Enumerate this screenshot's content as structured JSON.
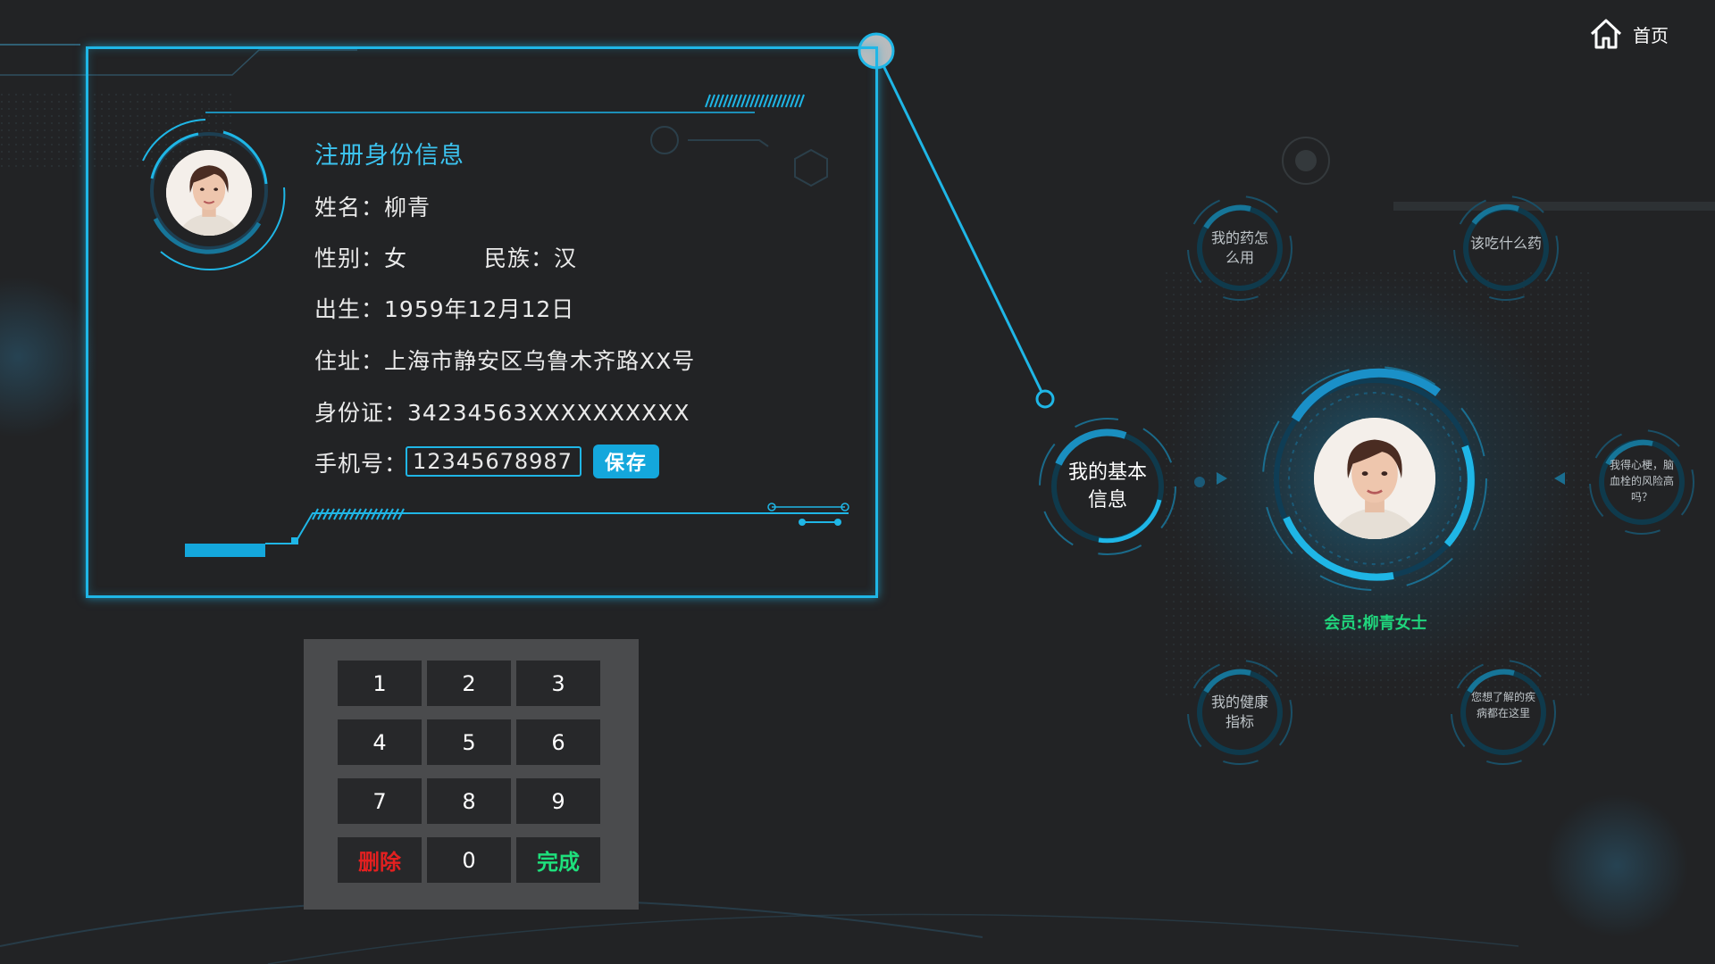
{
  "home": {
    "label": "首页",
    "icon": "house-icon"
  },
  "profile": {
    "title": "注册身份信息",
    "name_label": "姓名",
    "name_value": "柳青",
    "gender_label": "性别",
    "gender_value": "女",
    "ethnicity_label": "民族",
    "ethnicity_value": "汉",
    "birth_label": "出生",
    "birth_value": "1959年12月12日",
    "address_label": "住址",
    "address_value": "上海市静安区乌鲁木齐路XX号",
    "id_label": "身份证",
    "id_value": "34234563XXXXXXXXXX",
    "phone_label": "手机号",
    "phone_value": "12345678987",
    "save_label": "保存",
    "colon": "："
  },
  "keypad": {
    "keys": [
      "1",
      "2",
      "3",
      "4",
      "5",
      "6",
      "7",
      "8",
      "9",
      "删除",
      "0",
      "完成"
    ],
    "delete_color": "#e32020",
    "done_color": "#1ee07c"
  },
  "hub": {
    "basic_info": "我的基本信息",
    "medicine_usage": "我的药怎么用",
    "what_medicine": "该吃什么药",
    "health_index": "我的健康指标",
    "disease_info": "您想了解的疾病都在这里",
    "thrombosis_risk": "我得心梗，脑血栓的风险高吗？",
    "member": "会员:柳青女士"
  },
  "colors": {
    "accent": "#1fb6e6",
    "member": "#20d47c",
    "background": "#222325"
  }
}
